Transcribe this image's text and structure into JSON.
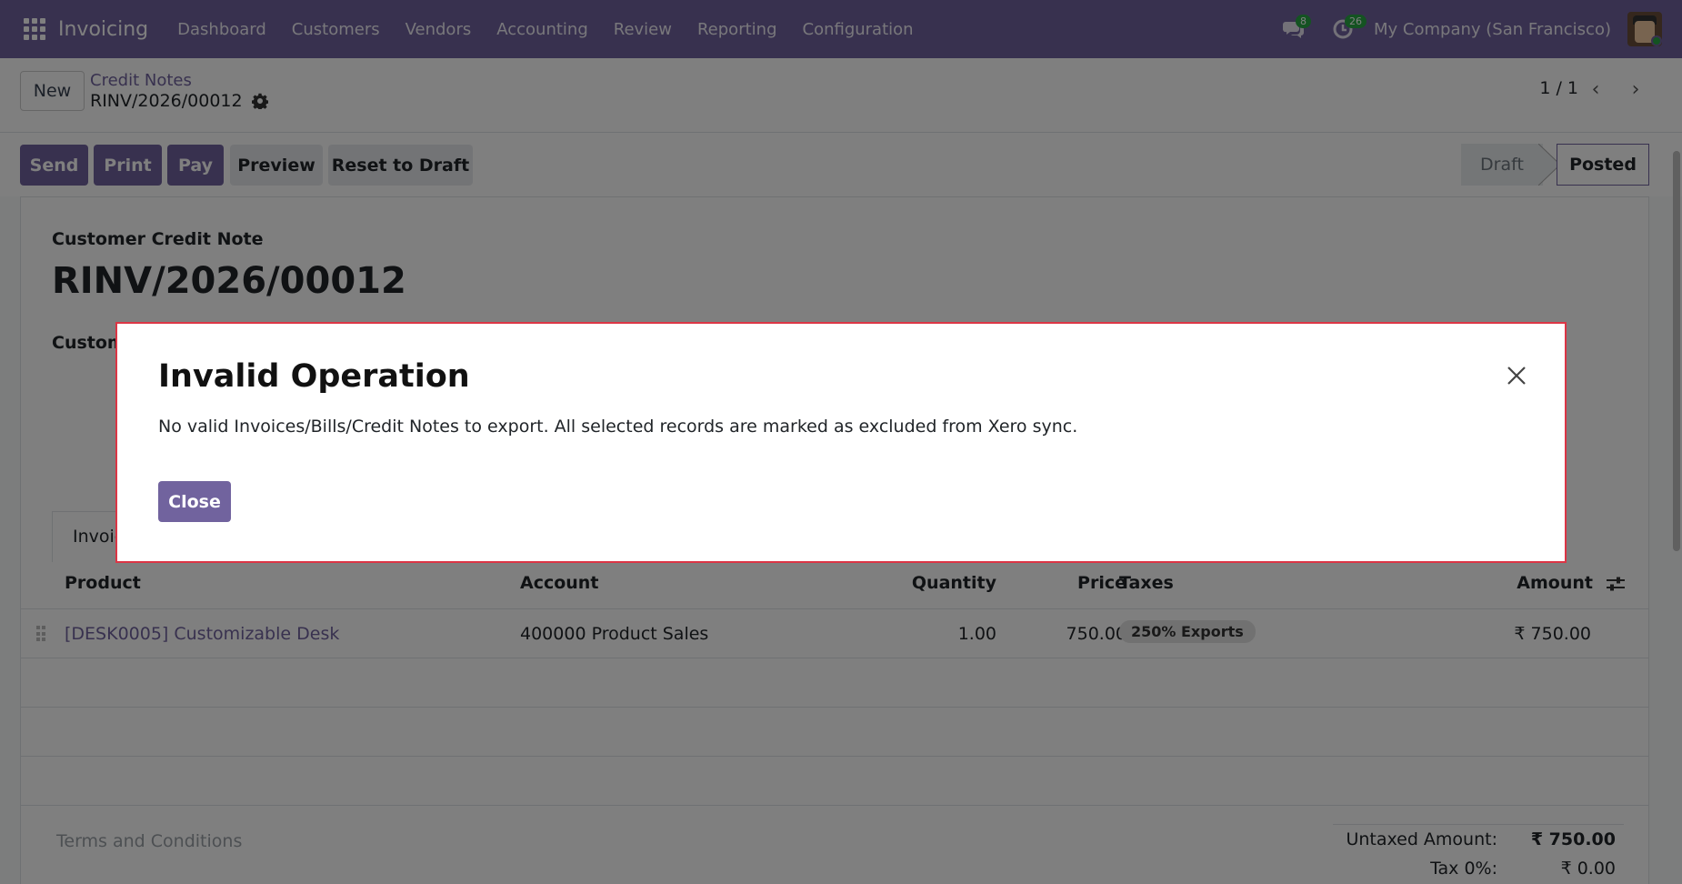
{
  "navbar": {
    "app_name": "Invoicing",
    "menu": [
      "Dashboard",
      "Customers",
      "Vendors",
      "Accounting",
      "Review",
      "Reporting",
      "Configuration"
    ],
    "messages_count": "8",
    "activities_count": "26",
    "company": "My Company (San Francisco)"
  },
  "control": {
    "new_label": "New",
    "breadcrumb": "Credit Notes",
    "record_name": "RINV/2026/00012",
    "pager": "1 / 1"
  },
  "statusbar": {
    "send": "Send",
    "print": "Print",
    "pay": "Pay",
    "preview": "Preview",
    "reset": "Reset to Draft",
    "stages": [
      "Draft",
      "Posted"
    ],
    "current_stage": "Posted"
  },
  "form": {
    "doc_type": "Customer Credit Note",
    "doc_number": "RINV/2026/00012",
    "customer_label_partial": "Custom",
    "tab_partial": "Invoic"
  },
  "table": {
    "headers": {
      "product": "Product",
      "account": "Account",
      "quantity": "Quantity",
      "price": "Price",
      "taxes": "Taxes",
      "amount": "Amount"
    },
    "rows": [
      {
        "product": "[DESK0005] Customizable Desk",
        "account": "400000 Product Sales",
        "quantity": "1.00",
        "price": "750.00",
        "tax": "250% Exports",
        "amount": "₹ 750.00"
      }
    ]
  },
  "footer": {
    "terms": "Terms and Conditions",
    "untaxed_label": "Untaxed Amount:",
    "untaxed_value": "₹ 750.00",
    "tax_label": "Tax 0%:",
    "tax_value": "₹ 0.00"
  },
  "modal": {
    "title": "Invalid Operation",
    "message": "No valid Invoices/Bills/Credit Notes to export. All selected records are marked as excluded from Xero sync.",
    "close_label": "Close"
  },
  "colors": {
    "brand": "#71639e",
    "danger": "#dc3545",
    "success_badge": "#28a745"
  }
}
